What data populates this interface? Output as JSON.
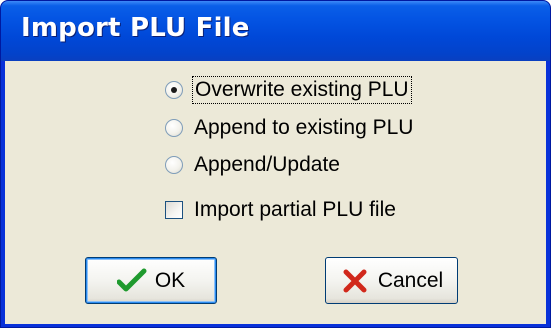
{
  "window": {
    "title": "Import PLU File"
  },
  "options": [
    {
      "label": "Overwrite existing PLU",
      "selected": true
    },
    {
      "label": "Append to existing PLU",
      "selected": false
    },
    {
      "label": "Append/Update",
      "selected": false
    }
  ],
  "checkbox": {
    "label": "Import partial PLU file",
    "checked": false
  },
  "buttons": {
    "ok_label": "OK",
    "ok_icon": "checkmark-icon",
    "cancel_label": "Cancel",
    "cancel_icon": "x-icon"
  },
  "colors": {
    "titlebar": "#0454e3",
    "client": "#ece9d8",
    "ok_check": "#1f9a2e",
    "cancel_x": "#d1281b"
  }
}
